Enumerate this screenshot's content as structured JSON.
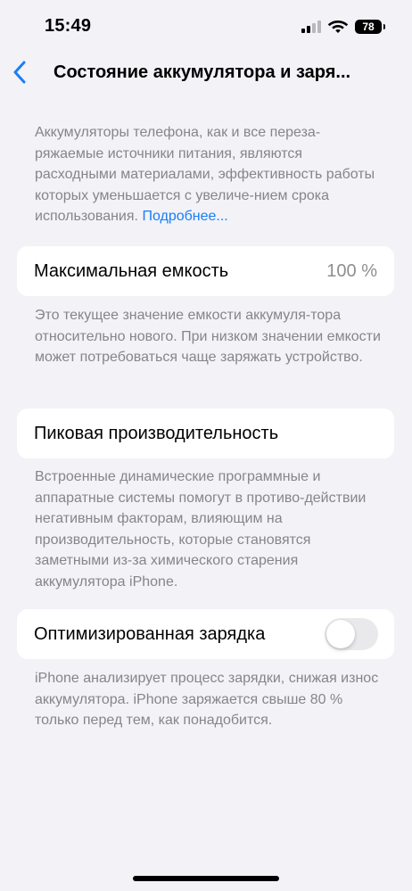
{
  "status_bar": {
    "time": "15:49",
    "battery_level": "78"
  },
  "nav": {
    "title": "Состояние аккумулятора и заря..."
  },
  "intro": {
    "text": "Аккумуляторы телефона, как и все переза-ряжаемые источники питания, являются расходными материалами, эффективность работы которых уменьшается с увеличе-нием срока использования.",
    "link": "Подробнее..."
  },
  "max_capacity": {
    "label": "Максимальная емкость",
    "value": "100 %",
    "footnote": "Это текущее значение емкости аккумуля-тора относительно нового. При низком значении емкости может потребоваться чаще заряжать устройство."
  },
  "peak_performance": {
    "label": "Пиковая производительность",
    "footnote": "Встроенные динамические программные и аппаратные системы помогут в противо-действии негативным факторам, влияющим на производительность, которые становятся заметными из-за химического старения аккумулятора iPhone."
  },
  "optimized_charging": {
    "label": "Оптимизированная зарядка",
    "enabled": false,
    "footnote": "iPhone анализирует процесс зарядки, снижая износ аккумулятора. iPhone заряжается свыше 80 % только перед тем, как понадобится."
  },
  "colors": {
    "accent": "#1a7ef5",
    "background": "#f2f2f7",
    "card": "#ffffff",
    "secondary_text": "#85858b",
    "toggle_off": "#e9e9eb"
  },
  "icons": {
    "back": "chevron-left-icon",
    "signal": "cellular-signal-icon",
    "wifi": "wifi-icon",
    "battery": "battery-icon"
  }
}
